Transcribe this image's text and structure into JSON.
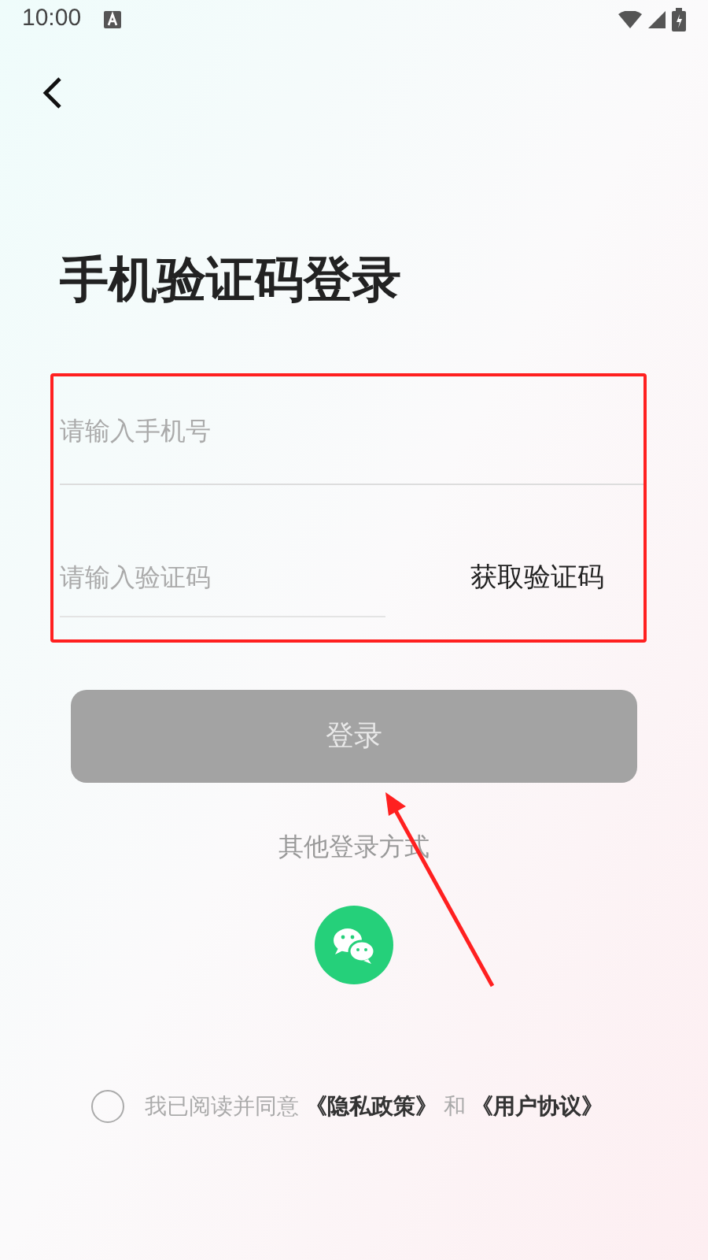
{
  "status_bar": {
    "time": "10:00"
  },
  "title": "手机验证码登录",
  "phone_field": {
    "placeholder": "请输入手机号"
  },
  "code_field": {
    "placeholder": "请输入验证码"
  },
  "get_code_button": {
    "label": "获取验证码"
  },
  "login_button": {
    "label": "登录",
    "disabled": true
  },
  "other_login": {
    "label": "其他登录方式"
  },
  "agreement": {
    "checked": false,
    "parts": [
      {
        "kind": "text",
        "text": "我已阅读并同意"
      },
      {
        "kind": "link",
        "text": "《隐私政策》"
      },
      {
        "kind": "text",
        "text": "和"
      },
      {
        "kind": "link",
        "text": "《用户协议》"
      }
    ]
  }
}
